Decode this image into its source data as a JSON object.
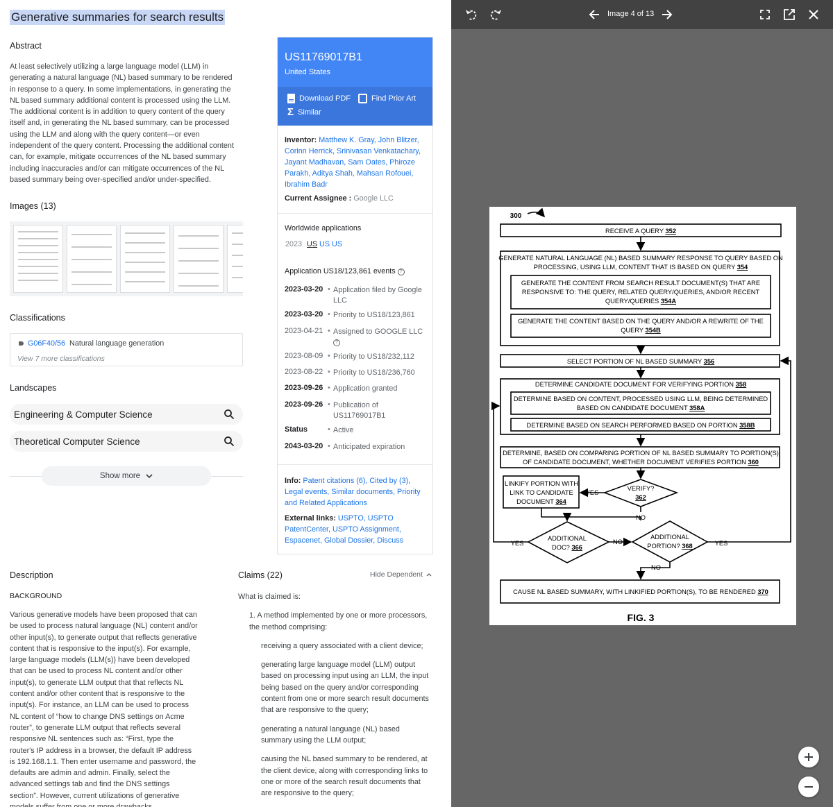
{
  "patent": {
    "title": "Generative summaries for search results",
    "abstract_heading": "Abstract",
    "abstract": "At least selectively utilizing a large language model (LLM) in generating a natural language (NL) based summary to be rendered in response to a query. In some implementations, in generating the NL based summary additional content is processed using the LLM. The additional content is in addition to query content of the query itself and, in generating the NL based summary, can be processed using the LLM and along with the query content—or even independent of the query content. Processing the additional content can, for example, mitigate occurrences of the NL based summary including inaccuracies and/or can mitigate occurrences of the NL based summary being over-specified and/or under-specified.",
    "images_heading": "Images (13)",
    "classifications_heading": "Classifications",
    "classification_code": "G06F40/56",
    "classification_name": "Natural language generation",
    "classification_more": "View 7 more classifications",
    "landscapes_heading": "Landscapes",
    "landscapes": [
      "Engineering & Computer Science",
      "Theoretical Computer Science"
    ],
    "show_more": "Show more",
    "description_heading": "Description",
    "background_heading": "BACKGROUND",
    "background": "Various generative models have been proposed that can be used to process natural language (NL) content and/or other input(s), to generate output that reflects generative content that is responsive to the input(s). For example, large language models (LLM(s)) have been developed that can be used to process NL content and/or other input(s), to generate LLM output that that reflects NL content and/or other content that is responsive to the input(s). For instance, an LLM can be used to process NL content of “how to change DNS settings on Acme router”, to generate LLM output that reflects several responsive NL sentences such as: “First, type the router's IP address in a browser, the default IP address is 192.168.1.1. Then enter username and password, the defaults are admin and admin. Finally, select the advanced settings tab and find the DNS settings section”. However, current utilizations of generative models suffer from one or more drawbacks.",
    "claims_heading": "Claims (22)",
    "hide_dependent": "Hide Dependent",
    "claims_intro": "What is claimed is:",
    "claim1": "1. A method implemented by one or more processors, the method comprising:",
    "claim1_steps": [
      "receiving a query associated with a client device;",
      "generating large language model (LLM) output based on processing input using an LLM, the input being based on the query and/or corresponding content from one or more search result documents that are responsive to the query;",
      "generating a natural language (NL) based summary using the LLM output;",
      "causing the NL based summary to be rendered, at the client device, along with corresponding links to one or more of the search result documents that are responsive to the query;"
    ]
  },
  "card": {
    "number": "US11769017B1",
    "country": "United States",
    "download_pdf": "Download PDF",
    "find_prior_art": "Find Prior Art",
    "similar": "Similar",
    "inventor_label": "Inventor:",
    "inventors": "Matthew K. Gray, John Blitzer, Corinn Herrick, Srinivasan Venkatachary, Jayant Madhavan, Sam Oates, Phiroze Parakh, Aditya Shah, Mahsan Rofouei, Ibrahim Badr",
    "assignee_label": "Current Assignee :",
    "assignee": "Google LLC",
    "worldwide_label": "Worldwide applications",
    "ww_year": "2023",
    "ww_us1": "US",
    "ww_us2": "US US",
    "events_label": "Application US18/123,861 events",
    "events": [
      {
        "date": "2023-03-20",
        "text": "Application filed by Google LLC"
      },
      {
        "date": "2023-03-20",
        "text": "Priority to US18/123,861"
      },
      {
        "date": "2023-04-21",
        "text": "Assigned to GOOGLE LLC"
      },
      {
        "date": "2023-08-09",
        "text": "Priority to US18/232,112"
      },
      {
        "date": "2023-08-22",
        "text": "Priority to US18/236,760"
      },
      {
        "date": "2023-09-26",
        "text": "Application granted"
      },
      {
        "date": "2023-09-26",
        "text": "Publication of US11769017B1"
      },
      {
        "date": "Status",
        "text": "Active"
      },
      {
        "date": "2043-03-20",
        "text": "Anticipated expiration"
      }
    ],
    "info_label": "Info:",
    "info_links": "Patent citations (6), Cited by (3), Legal events, Similar documents, Priority and Related Applications",
    "external_label": "External links:",
    "external_links": "USPTO, USPTO PatentCenter, USPTO Assignment, Espacenet, Global Dossier, Discuss"
  },
  "viewer": {
    "counter": "Image 4 of 13"
  },
  "figure": {
    "fig_number": "300",
    "caption": "FIG. 3",
    "receive": "RECEIVE A QUERY",
    "receive_ref": "352",
    "gen1": "GENERATE NATURAL LANGUAGE (NL) BASED SUMMARY RESPONSE TO QUERY BASED ON",
    "gen2": "PROCESSING, USING LLM, CONTENT THAT IS BASED ON QUERY",
    "gen_ref": "354",
    "a1": "GENERATE THE CONTENT FROM SEARCH RESULT DOCUMENT(S) THAT ARE",
    "a2": "RESPONSIVE TO:  THE QUERY, RELATED QUERY/QUERIES, AND/OR RECENT",
    "a3": "QUERY/QUERIES",
    "a_ref": "354A",
    "b1": "GENERATE THE CONTENT BASED ON THE QUERY AND/OR A REWRITE OF THE",
    "b2": "QUERY",
    "b_ref": "354B",
    "select": "SELECT PORTION OF NL BASED SUMMARY",
    "select_ref": "356",
    "det": "DETERMINE CANDIDATE DOCUMENT FOR VERIFYING PORTION",
    "det_ref": "358",
    "da1": "DETERMINE BASED ON CONTENT, PROCESSED USING LLM, BEING DETERMINED",
    "da2": "BASED ON CANDIDATE DOCUMENT",
    "da_ref": "358A",
    "db": "DETERMINE BASED ON SEARCH PERFORMED BASED ON PORTION",
    "db_ref": "358B",
    "cmp1": "DETERMINE, BASED ON COMPARING PORTION OF NL BASED SUMMARY TO PORTION(S)",
    "cmp2": "OF CANDIDATE DOCUMENT, WHETHER DOCUMENT VERIFIES PORTION",
    "cmp_ref": "360",
    "link1": "LINKIFY PORTION WITH",
    "link2": "LINK TO CANDIDATE",
    "link3": "DOCUMENT",
    "link_ref": "364",
    "verify": "VERIFY?",
    "verify_ref": "362",
    "adddoc": "ADDITIONAL",
    "adddoc2": "DOC?",
    "adddoc_ref": "366",
    "addpor": "ADDITIONAL",
    "addpor2": "PORTION?",
    "addpor_ref": "368",
    "render": "CAUSE NL BASED SUMMARY, WITH LINKIFIED PORTION(S), TO BE RENDERED",
    "render_ref": "370",
    "yes": "YES",
    "no": "NO"
  }
}
